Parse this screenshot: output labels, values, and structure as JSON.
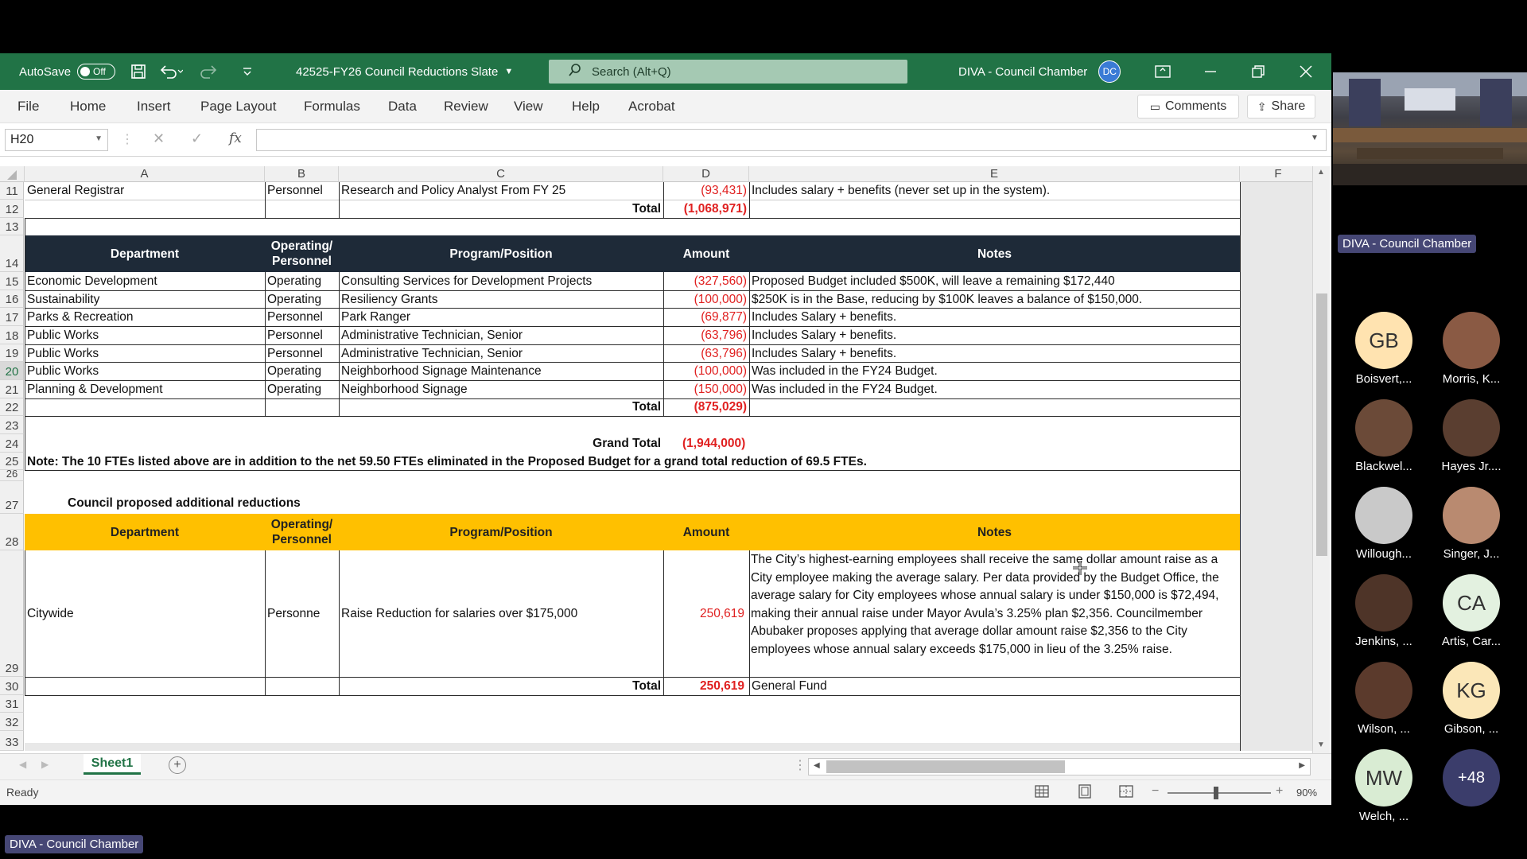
{
  "window": {
    "autosave_label": "AutoSave",
    "autosave_state": "Off",
    "file_title": "42525-FY26 Council Reductions Slate",
    "search_placeholder": "Search (Alt+Q)",
    "account_name": "DIVA - Council Chamber",
    "account_initials": "DC",
    "accent": "#217346"
  },
  "menu": {
    "items": [
      "File",
      "Home",
      "Insert",
      "Page Layout",
      "Formulas",
      "Data",
      "Review",
      "View",
      "Help",
      "Acrobat"
    ],
    "comments": "Comments",
    "share": "Share"
  },
  "formula_bar": {
    "name_box": "H20",
    "fx": "fx",
    "value": ""
  },
  "columns": [
    "A",
    "B",
    "C",
    "D",
    "E",
    "F"
  ],
  "rows": {
    "r11": {
      "num": "11",
      "dept": "General Registrar",
      "type": "Personnel",
      "program": "Research and Policy Analyst From FY 25",
      "amount": "(93,431)",
      "note": "Includes salary + benefits (never set up in the system)."
    },
    "r12": {
      "num": "12",
      "label": "Total",
      "amount": "(1,068,971)"
    },
    "r13": {
      "num": "13"
    },
    "header1": {
      "num": "14",
      "dept": "Department",
      "type_line1": "Operating/",
      "type_line2": "Personnel",
      "program": "Program/Position",
      "amount": "Amount",
      "notes": "Notes"
    },
    "data": [
      {
        "num": "15",
        "dept": "Economic Development",
        "type": "Operating",
        "program": "Consulting Services for Development Projects",
        "amount": "(327,560)",
        "note": "Proposed Budget included $500K, will leave a remaining $172,440"
      },
      {
        "num": "16",
        "dept": "Sustainability",
        "type": "Operating",
        "program": "Resiliency Grants",
        "amount": "(100,000)",
        "note": "$250K is in the Base, reducing by $100K leaves a balance of $150,000."
      },
      {
        "num": "17",
        "dept": "Parks & Recreation",
        "type": "Personnel",
        "program": "Park Ranger",
        "amount": "(69,877)",
        "note": "Includes Salary + benefits."
      },
      {
        "num": "18",
        "dept": "Public Works",
        "type": "Personnel",
        "program": "Administrative Technician, Senior",
        "amount": "(63,796)",
        "note": "Includes Salary + benefits."
      },
      {
        "num": "19",
        "dept": "Public Works",
        "type": "Personnel",
        "program": "Administrative Technician, Senior",
        "amount": "(63,796)",
        "note": "Includes Salary + benefits."
      },
      {
        "num": "20",
        "dept": "Public Works",
        "type": "Operating",
        "program": "Neighborhood Signage Maintenance",
        "amount": "(100,000)",
        "note": "Was included in the FY24 Budget."
      },
      {
        "num": "21",
        "dept": "Planning & Development",
        "type": "Operating",
        "program": "Neighborhood Signage",
        "amount": "(150,000)",
        "note": "Was included in the FY24 Budget."
      }
    ],
    "r22": {
      "num": "22",
      "label": "Total",
      "amount": "(875,029)"
    },
    "r23": {
      "num": "23"
    },
    "r24": {
      "num": "24",
      "label": "Grand Total",
      "amount": "(1,944,000)"
    },
    "r25": {
      "num": "25",
      "note": "Note: The 10 FTEs listed above are in addition to the net 59.50 FTEs eliminated in the Proposed Budget for a grand total reduction of 69.5 FTEs."
    },
    "r26": {
      "num": "26"
    },
    "r27": {
      "num": "27",
      "title": "Council proposed additional reductions"
    },
    "header2": {
      "num": "28",
      "dept": "Department",
      "type_line1": "Operating/",
      "type_line2": "Personnel",
      "program": "Program/Position",
      "amount": "Amount",
      "notes": "Notes"
    },
    "r29": {
      "num": "29",
      "dept": "Citywide",
      "type": "Personne",
      "program": "Raise Reduction for salaries over $175,000",
      "amount": "250,619",
      "note": "The City’s highest-earning employees shall receive the same dollar amount raise as a City employee making the average salary. Per data provided by the Budget Office, the average salary for City employees whose annual salary is under $150,000 is $72,494, making their annual raise under Mayor Avula’s 3.25% plan $2,356. Councilmember Abubaker proposes applying that average dollar amount raise $2,356 to the City employees whose annual salary exceeds $175,000 in lieu of the 3.25% raise."
    },
    "r30": {
      "num": "30",
      "label": "Total",
      "amount": "250,619",
      "note": "General Fund"
    },
    "r31": {
      "num": "31"
    },
    "r32": {
      "num": "32"
    },
    "r33": {
      "num": "33"
    }
  },
  "sheets": {
    "active": "Sheet1"
  },
  "status": {
    "state": "Ready",
    "zoom": "90%"
  },
  "meeting": {
    "room_label": "DIVA - Council Chamber",
    "bottom_label": "DIVA - Council Chamber",
    "participants": [
      {
        "name": "Boisvert,...",
        "initials": "GB",
        "color": "#ffe3b0"
      },
      {
        "name": "Morris, K...",
        "initials": "",
        "color": "#8a5a44"
      },
      {
        "name": "Blackwel...",
        "initials": "",
        "color": "#6b4a38"
      },
      {
        "name": "Hayes Jr....",
        "initials": "",
        "color": "#5a3e30"
      },
      {
        "name": "Willough...",
        "initials": "",
        "color": "#c9c9c9"
      },
      {
        "name": "Singer, J...",
        "initials": "",
        "color": "#b98a70"
      },
      {
        "name": "Jenkins, ...",
        "initials": "",
        "color": "#4e3428"
      },
      {
        "name": "Artis, Car...",
        "initials": "CA",
        "color": "#e3f1e0"
      },
      {
        "name": "Wilson, ...",
        "initials": "",
        "color": "#5b3a2c"
      },
      {
        "name": "Gibson, ...",
        "initials": "KG",
        "color": "#fbe7b8"
      },
      {
        "name": "Welch, ...",
        "initials": "MW",
        "color": "#d9ecd3"
      }
    ],
    "more_count": "+48"
  }
}
